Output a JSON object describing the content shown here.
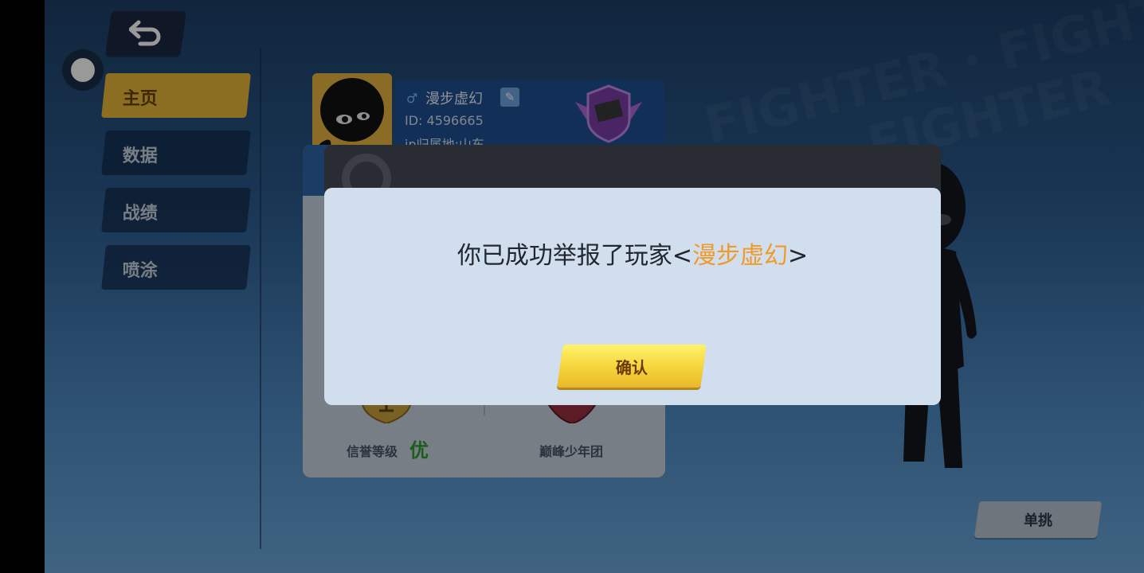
{
  "nav": {
    "items": [
      {
        "label": "主页",
        "active": true
      },
      {
        "label": "数据",
        "active": false
      },
      {
        "label": "战绩",
        "active": false
      },
      {
        "label": "喷涂",
        "active": false
      }
    ]
  },
  "profile": {
    "name": "漫步虚幻",
    "id": "ID: 4596665",
    "ip_location": "ip归属地:山东"
  },
  "stats": {
    "credit_label": "信誉等级",
    "credit_value": "优",
    "team_label": "巅峰少年团"
  },
  "actions": {
    "duel_label": "单挑"
  },
  "dialog": {
    "message_prefix": "你已成功举报了玩家<",
    "reported_player": "漫步虚幻",
    "message_suffix": ">",
    "confirm_label": "确认"
  },
  "colors": {
    "accent": "#f09a2a",
    "nav_active": "#e8b83a",
    "credit_good": "#2e9c2a",
    "confirm": "#f5d33a"
  }
}
